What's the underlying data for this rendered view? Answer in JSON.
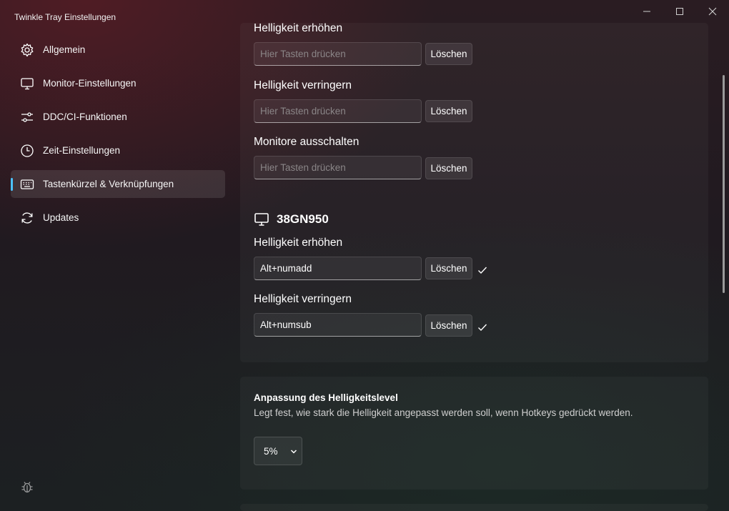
{
  "window": {
    "title": "Twinkle Tray Einstellungen"
  },
  "sidebar": {
    "items": [
      {
        "label": "Allgemein",
        "icon": "gear-icon"
      },
      {
        "label": "Monitor-Einstellungen",
        "icon": "monitor-icon"
      },
      {
        "label": "DDC/CI-Funktionen",
        "icon": "sliders-icon"
      },
      {
        "label": "Zeit-Einstellungen",
        "icon": "clock-icon"
      },
      {
        "label": "Tastenkürzel & Verknüpfungen",
        "icon": "keyboard-icon",
        "active": true
      },
      {
        "label": "Updates",
        "icon": "refresh-icon"
      }
    ],
    "footer_icon": "bug-icon"
  },
  "hotkeys": {
    "all_monitors": [
      {
        "label": "Helligkeit erhöhen",
        "value": "",
        "placeholder": "Hier Tasten drücken",
        "clear_label": "Löschen"
      },
      {
        "label": "Helligkeit verringern",
        "value": "",
        "placeholder": "Hier Tasten drücken",
        "clear_label": "Löschen"
      },
      {
        "label": "Monitore ausschalten",
        "value": "",
        "placeholder": "Hier Tasten drücken",
        "clear_label": "Löschen"
      }
    ],
    "monitor": {
      "name": "38GN950",
      "items": [
        {
          "label": "Helligkeit erhöhen",
          "value": "Alt+numadd",
          "clear_label": "Löschen",
          "saved": true
        },
        {
          "label": "Helligkeit verringern",
          "value": "Alt+numsub",
          "clear_label": "Löschen",
          "saved": true
        }
      ]
    }
  },
  "brightness_level": {
    "title": "Anpassung des Helligkeitslevel",
    "description": "Legt fest, wie stark die Helligkeit angepasst werden soll, wenn Hotkeys gedrückt werden.",
    "selected": "5%"
  },
  "colors": {
    "accent": "#4cc2ff"
  }
}
